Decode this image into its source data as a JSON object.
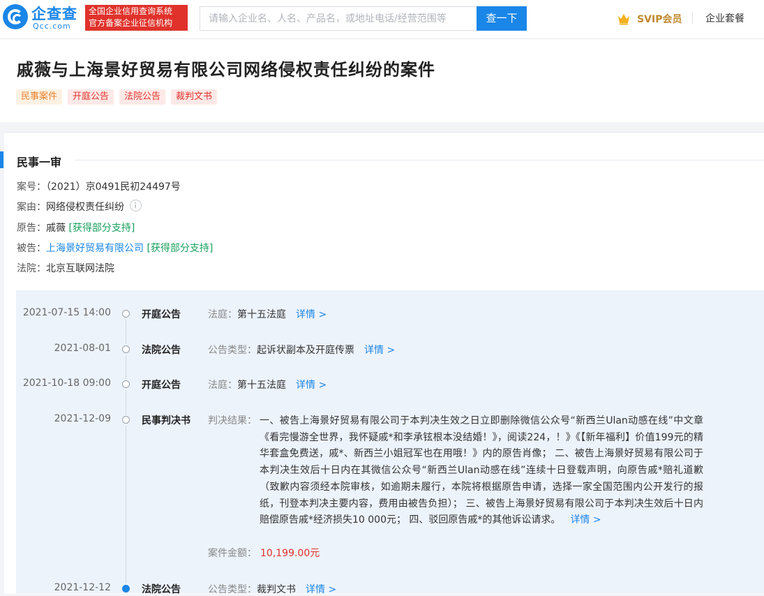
{
  "header": {
    "logo_name": "企查查",
    "logo_domain": "Qcc.com",
    "badge_line1": "全国企业信用查询系统",
    "badge_line2": "官方备案企业征信机构",
    "search_placeholder": "请输入企业名、人名、产品名，或地址电话/经营范围等",
    "search_button": "查一下",
    "svip_label": "SVIP会员",
    "enterprise_label": "企业套餐",
    "colors": {
      "brand_blue": "#1a86e8",
      "badge_red": "#e0322b",
      "svip_gold": "#c08a2d"
    }
  },
  "case": {
    "title": "戚薇与上海景好贸易有限公司网络侵权责任纠纷的案件",
    "tags": [
      {
        "label": "民事案件",
        "color": "#e8822e",
        "bg": "#fdf1e3"
      },
      {
        "label": "开庭公告",
        "color": "#e0322b",
        "bg": "#fde9e8"
      },
      {
        "label": "法院公告",
        "color": "#e0322b",
        "bg": "#fde9e8"
      },
      {
        "label": "裁判文书",
        "color": "#e0322b",
        "bg": "#fde9e8"
      }
    ]
  },
  "section": {
    "title": "民事一审",
    "case_no_label": "案号：",
    "case_no": "（2021）京0491民初24497号",
    "cause_label": "案由：",
    "cause": "网络侵权责任纠纷",
    "plaintiff_label": "原告：",
    "plaintiff": "戚薇",
    "plaintiff_result": "[获得部分支持]",
    "defendant_label": "被告：",
    "defendant": "上海景好贸易有限公司",
    "defendant_result": "[获得部分支持]",
    "court_label": "法院：",
    "court": "北京互联网法院"
  },
  "timeline": [
    {
      "date": "2021-07-15 14:00",
      "type": "开庭公告",
      "detail_label": "法庭：",
      "detail_value": "第十五法庭",
      "more": "详情 >"
    },
    {
      "date": "2021-08-01",
      "type": "法院公告",
      "detail_label": "公告类型：",
      "detail_value": "起诉状副本及开庭传票",
      "more": "详情 >"
    },
    {
      "date": "2021-10-18 09:00",
      "type": "开庭公告",
      "detail_label": "法庭：",
      "detail_value": "第十五法庭",
      "more": "详情 >"
    },
    {
      "date": "2021-12-09",
      "type": "民事判决书",
      "detail_label": "判决结果：",
      "detail_value": "一、被告上海景好贸易有限公司于本判决生效之日立即删除微信公众号“新西兰Ulan动感在线”中文章《看完慢游全世界，我怀疑戚*和李承铉根本没结婚！》，阅读224，！》《【新年福利】价值199元的精华套盒免费送，戚*、新西兰小姐冠军也在用哦！》内的原告肖像；  二、被告上海景好贸易有限公司于本判决生效后十日内在其微信公众号“新西兰Ulan动感在线”连续十日登载声明，向原告戚*赔礼道歉（致歉内容须经本院审核，如逾期未履行，本院将根据原告申请，选择一家全国范围内公开发行的报纸，刊登本判决主要内容，费用由被告负担）；  三、被告上海景好贸易有限公司于本判决生效后十日内赔偿原告戚*经济损失10 000元；  四、驳回原告戚*的其他诉讼请求。",
      "more": "详情 >",
      "amount_label": "案件金额：",
      "amount": "10,199.00元"
    },
    {
      "date": "2021-12-12",
      "type": "法院公告",
      "detail_label": "公告类型：",
      "detail_value": "裁判文书",
      "more": "详情 >",
      "current": true
    }
  ]
}
